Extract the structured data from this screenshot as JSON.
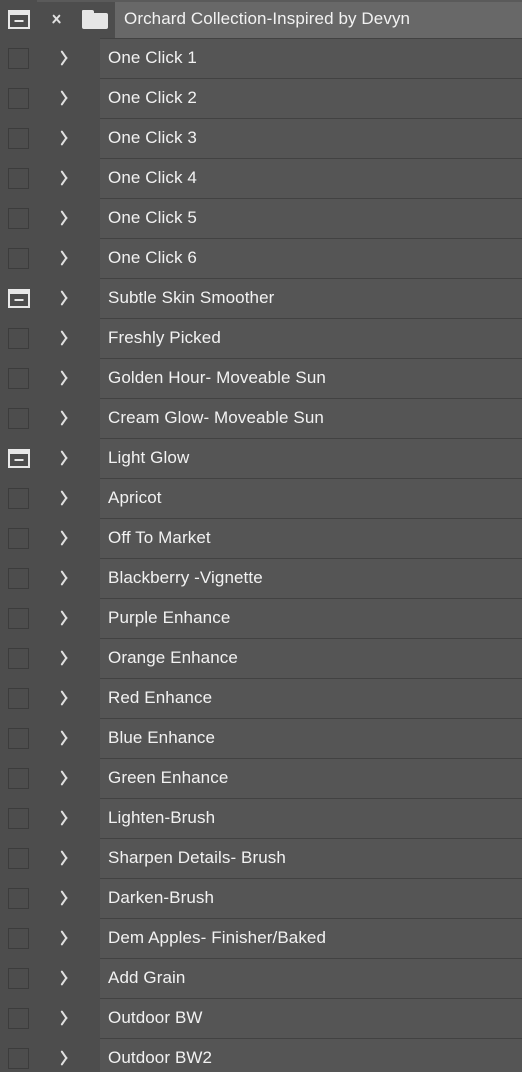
{
  "panel": {
    "background_color": "#4d4d4d",
    "row_color": "#555555",
    "header_color": "#686868",
    "separator_color": "#424242",
    "text_color": "#f2f2f2"
  },
  "group": {
    "title": "Orchard Collection-Inspired by Devyn",
    "mask_icon": "layer-mask-icon",
    "twisty_icon": "chevron-down-icon",
    "folder_icon": "folder-icon",
    "expanded": true,
    "selected": true
  },
  "layers": [
    {
      "label": "One Click 1",
      "icon": "checkbox-empty-icon",
      "twisty": "chevron-right-icon"
    },
    {
      "label": "One Click 2",
      "icon": "checkbox-empty-icon",
      "twisty": "chevron-right-icon"
    },
    {
      "label": "One Click 3",
      "icon": "checkbox-empty-icon",
      "twisty": "chevron-right-icon"
    },
    {
      "label": "One Click 4",
      "icon": "checkbox-empty-icon",
      "twisty": "chevron-right-icon"
    },
    {
      "label": "One Click 5",
      "icon": "checkbox-empty-icon",
      "twisty": "chevron-right-icon"
    },
    {
      "label": "One Click 6",
      "icon": "checkbox-empty-icon",
      "twisty": "chevron-right-icon"
    },
    {
      "label": "Subtle Skin Smoother",
      "icon": "layer-mask-icon",
      "twisty": "chevron-right-icon"
    },
    {
      "label": "Freshly Picked",
      "icon": "checkbox-empty-icon",
      "twisty": "chevron-right-icon"
    },
    {
      "label": "Golden Hour- Moveable Sun",
      "icon": "checkbox-empty-icon",
      "twisty": "chevron-right-icon"
    },
    {
      "label": "Cream Glow- Moveable Sun",
      "icon": "checkbox-empty-icon",
      "twisty": "chevron-right-icon"
    },
    {
      "label": "Light Glow",
      "icon": "layer-mask-icon",
      "twisty": "chevron-right-icon"
    },
    {
      "label": "Apricot",
      "icon": "checkbox-empty-icon",
      "twisty": "chevron-right-icon"
    },
    {
      "label": "Off To Market",
      "icon": "checkbox-empty-icon",
      "twisty": "chevron-right-icon"
    },
    {
      "label": "Blackberry -Vignette",
      "icon": "checkbox-empty-icon",
      "twisty": "chevron-right-icon"
    },
    {
      "label": "Purple Enhance",
      "icon": "checkbox-empty-icon",
      "twisty": "chevron-right-icon"
    },
    {
      "label": "Orange Enhance",
      "icon": "checkbox-empty-icon",
      "twisty": "chevron-right-icon"
    },
    {
      "label": "Red Enhance",
      "icon": "checkbox-empty-icon",
      "twisty": "chevron-right-icon"
    },
    {
      "label": "Blue Enhance",
      "icon": "checkbox-empty-icon",
      "twisty": "chevron-right-icon"
    },
    {
      "label": "Green Enhance",
      "icon": "checkbox-empty-icon",
      "twisty": "chevron-right-icon"
    },
    {
      "label": "Lighten-Brush",
      "icon": "checkbox-empty-icon",
      "twisty": "chevron-right-icon"
    },
    {
      "label": "Sharpen Details- Brush",
      "icon": "checkbox-empty-icon",
      "twisty": "chevron-right-icon"
    },
    {
      "label": "Darken-Brush",
      "icon": "checkbox-empty-icon",
      "twisty": "chevron-right-icon"
    },
    {
      "label": "Dem Apples- Finisher/Baked",
      "icon": "checkbox-empty-icon",
      "twisty": "chevron-right-icon"
    },
    {
      "label": "Add Grain",
      "icon": "checkbox-empty-icon",
      "twisty": "chevron-right-icon"
    },
    {
      "label": "Outdoor BW",
      "icon": "checkbox-empty-icon",
      "twisty": "chevron-right-icon"
    },
    {
      "label": "Outdoor BW2",
      "icon": "checkbox-empty-icon",
      "twisty": "chevron-right-icon"
    }
  ]
}
